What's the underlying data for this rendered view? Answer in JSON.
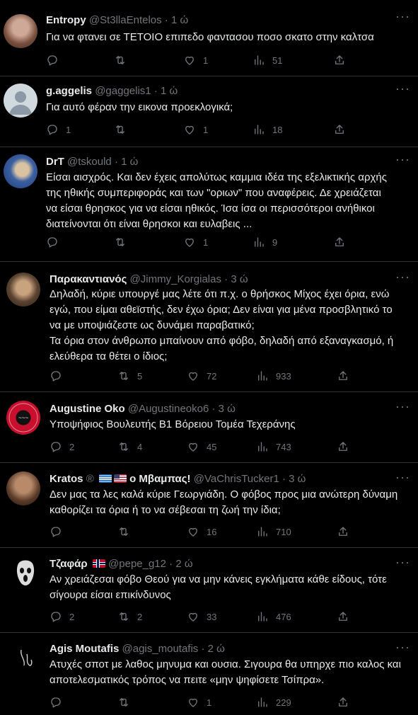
{
  "tweets": [
    {
      "name": "Entropy",
      "handle": "@St3llaEntelos",
      "time": "1 ώ",
      "lines": [
        "Για να φτανει σε ΤΕΤΟΙΟ επιπεδο φαντασου ποσο σκατο στην καλτσα"
      ],
      "replies": "",
      "retweets": "",
      "likes": "1",
      "views": "51"
    },
    {
      "name": "g.aggelis",
      "handle": "@gaggelis1",
      "time": "1 ώ",
      "lines": [
        "Για αυτό φέραν την εικονα προεκλογικά;"
      ],
      "replies": "1",
      "retweets": "",
      "likes": "1",
      "views": "18"
    },
    {
      "name": "DrT",
      "handle": "@tskould",
      "time": "1 ώ",
      "lines": [
        "Είσαι αισχρός.  Και δεν έχεις απολύτως καμμια ιδέα της εξελικτικής αρχής",
        "της ηθικής συμπεριφοράς και των \"οριων\" που αναφέρεις. Δε χρειάζεται",
        "να είσαι θρησκος για να είσαι ηθικός. Ίσα ίσα οι περισσότεροι ανήθικοι",
        "διατείνονται ότι είναι θρησκοι και ευλαβεις ..."
      ],
      "replies": "",
      "retweets": "",
      "likes": "1",
      "views": "9"
    },
    {
      "name": "Παρακαντιανός",
      "handle": "@Jimmy_Korgialas",
      "time": "3 ώ",
      "lines": [
        "Δηλαδή, κύριε υπουργέ μας λέτε ότι π.χ. ο θρήσκος Μίχος έχει όρια, ενώ",
        "εγώ, που είμαι αθεϊστής, δεν έχω όρια; Δεν είναι για μένα προσβλητικό το",
        "να με υποψιάζεστε ως δυνάμει παραβατικό;",
        "Τα όρια στον άνθρωπο μπαίνουν από φόβο, δηλαδή από εξαναγκασμό, ή",
        "ελεύθερα τα θέτει ο ίδιος;"
      ],
      "replies": "",
      "retweets": "5",
      "likes": "72",
      "views": "933"
    },
    {
      "name": "Augustine Oko",
      "handle": "@Augustineoko6",
      "time": "3 ώ",
      "lines": [
        "Υποψήφιος Βουλευτής Β1 Βόρειου Τομέα Τεχεράνης"
      ],
      "replies": "2",
      "retweets": "4",
      "likes": "45",
      "views": "743"
    },
    {
      "name": "Kratos",
      "name_suffix": "ο Μβαμπας!",
      "handle": "@VaChrisTucker1",
      "time": "3 ώ",
      "lines": [
        "Δεν μας τα λες καλά κύριε Γεωργιάδη. Ο φόβος προς μια ανώτερη δύναμη",
        "καθορίζει τα όρια ή το να σέβεσαι τη ζωή την ίδια;"
      ],
      "replies": "",
      "retweets": "",
      "likes": "16",
      "views": "710"
    },
    {
      "name": "Τζαφάρ",
      "handle": "@pepe_g12",
      "time": "2 ώ",
      "lines": [
        "Αν χρειάζεσαι φόβο Θεού για να μην κάνεις εγκλήματα κάθε είδους, τότε",
        "σίγουρα είσαι επικίνδυνος"
      ],
      "replies": "2",
      "retweets": "2",
      "likes": "33",
      "views": "476"
    },
    {
      "name": "Agis Moutafis",
      "handle": "@agis_moutafis",
      "time": "2 ώ",
      "lines": [
        "Ατυχές σποτ με λαθος μηνυμα και ουσια. Σιγουρα θα υπηρχε πιο καλος και",
        "αποτελεσματικός τρόπος να πειτε «μην ψηφίσετε Τσίπρα»."
      ],
      "replies": "",
      "retweets": "",
      "likes": "1",
      "views": "229"
    }
  ],
  "icons": {
    "reply": "reply-icon",
    "retweet": "retweet-icon",
    "like": "heart-icon",
    "views": "views-icon",
    "share": "share-icon",
    "more": "more-icon"
  },
  "colors": {
    "background": "#000000",
    "text": "#e7e9ea",
    "muted": "#71767b",
    "divider": "#2f3336"
  }
}
